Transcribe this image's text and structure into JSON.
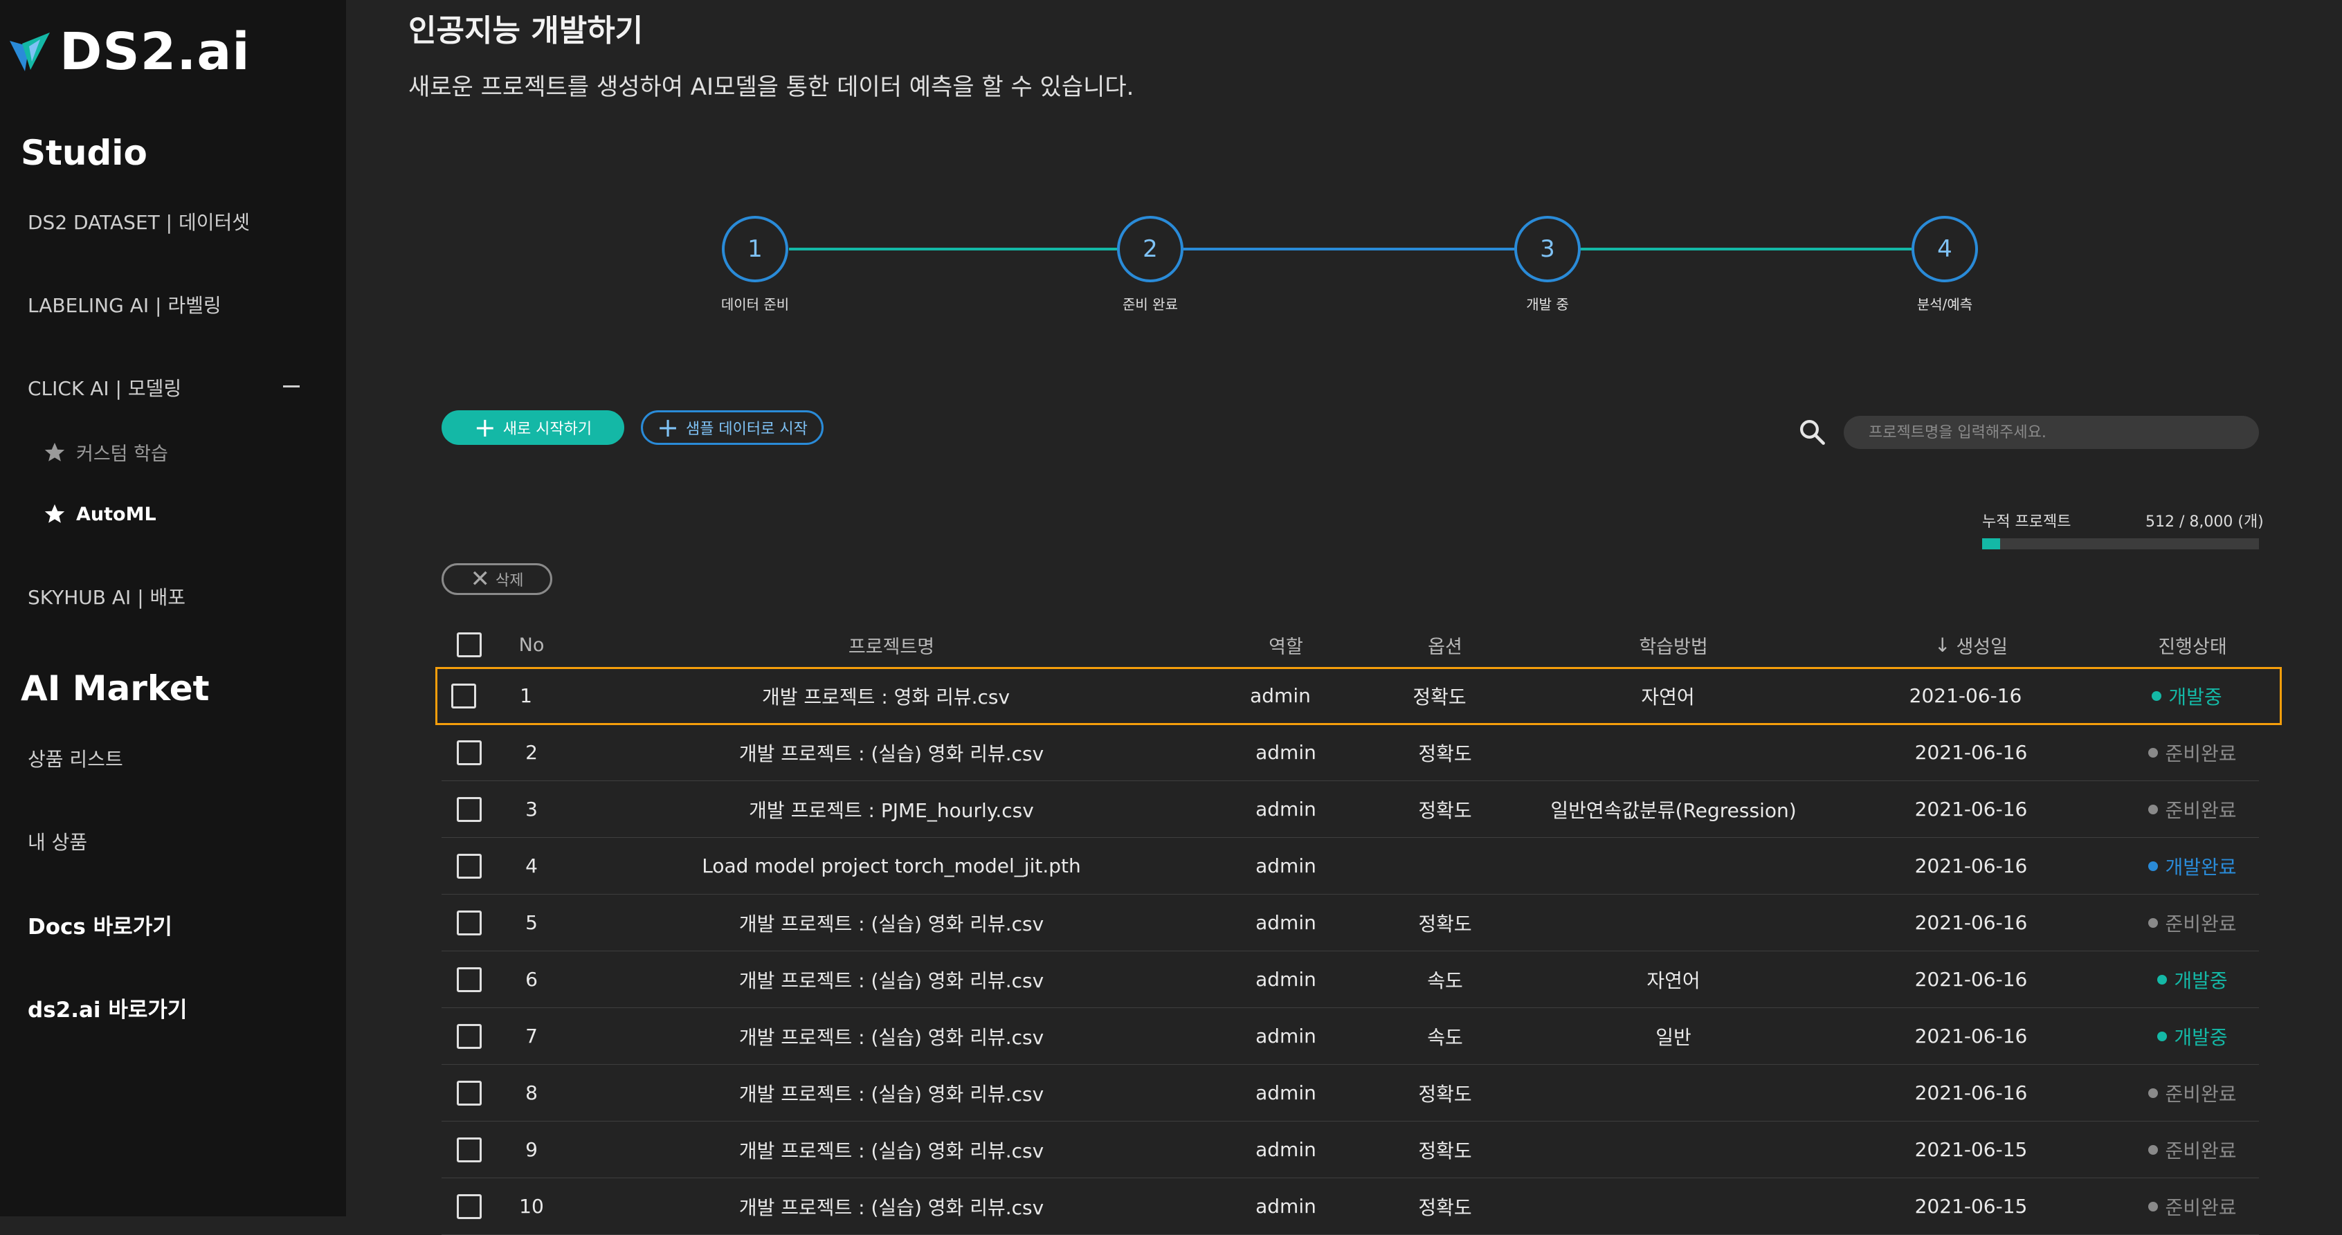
{
  "brand": {
    "logo_text": "DS2.ai"
  },
  "sidebar": {
    "studio_title": "Studio",
    "items": {
      "dataset": "DS2 DATASET | 데이터셋",
      "labeling": "LABELING AI | 라벨링",
      "clickai": "CLICK AI | 모델링",
      "custom": "커스텀 학습",
      "automl": "AutoML",
      "skyhub": "SKYHUB AI | 배포"
    },
    "market_title": "AI Market",
    "market_items": {
      "product_list": "상품 리스트",
      "my_products": "내 상품"
    },
    "docs_link": "Docs 바로가기",
    "ds2_link": "ds2.ai 바로가기"
  },
  "header": {
    "title": "인공지능 개발하기",
    "description": "새로운 프로젝트를 생성하여 AI모델을 통한 데이터 예측을 할 수 있습니다."
  },
  "steps": [
    {
      "number": "1",
      "label": "데이터 준비"
    },
    {
      "number": "2",
      "label": "준비 완료"
    },
    {
      "number": "3",
      "label": "개발 중"
    },
    {
      "number": "4",
      "label": "분석/예측"
    }
  ],
  "toolbar": {
    "new_start": "새로 시작하기",
    "sample_start": "샘플 데이터로 시작",
    "search_placeholder": "프로젝트명을 입력해주세요.",
    "delete": "삭제"
  },
  "cumulative": {
    "label": "누적 프로젝트",
    "value_text": "512 / 8,000 (개)",
    "used": 512,
    "total": 8000
  },
  "table": {
    "headers": {
      "no": "No",
      "name": "프로젝트명",
      "role": "역할",
      "option": "옵션",
      "method": "학습방법",
      "date": "생성일",
      "status": "진행상태"
    },
    "rows": [
      {
        "no": "1",
        "name": "개발 프로젝트 : 영화 리뷰.csv",
        "role": "admin",
        "option": "정확도",
        "method": "자연어",
        "date": "2021-06-16",
        "status": "개발중"
      },
      {
        "no": "2",
        "name": "개발 프로젝트 : (실습) 영화 리뷰.csv",
        "role": "admin",
        "option": "정확도",
        "method": "",
        "date": "2021-06-16",
        "status": "준비완료"
      },
      {
        "no": "3",
        "name": "개발 프로젝트 : PJME_hourly.csv",
        "role": "admin",
        "option": "정확도",
        "method": "일반연속값분류(Regression)",
        "date": "2021-06-16",
        "status": "준비완료"
      },
      {
        "no": "4",
        "name": "Load model project torch_model_jit.pth",
        "role": "admin",
        "option": "",
        "method": "",
        "date": "2021-06-16",
        "status": "개발완료"
      },
      {
        "no": "5",
        "name": "개발 프로젝트 : (실습) 영화 리뷰.csv",
        "role": "admin",
        "option": "정확도",
        "method": "",
        "date": "2021-06-16",
        "status": "준비완료"
      },
      {
        "no": "6",
        "name": "개발 프로젝트 : (실습) 영화 리뷰.csv",
        "role": "admin",
        "option": "속도",
        "method": "자연어",
        "date": "2021-06-16",
        "status": "개발중"
      },
      {
        "no": "7",
        "name": "개발 프로젝트 : (실습) 영화 리뷰.csv",
        "role": "admin",
        "option": "속도",
        "method": "일반",
        "date": "2021-06-16",
        "status": "개발중"
      },
      {
        "no": "8",
        "name": "개발 프로젝트 : (실습) 영화 리뷰.csv",
        "role": "admin",
        "option": "정확도",
        "method": "",
        "date": "2021-06-16",
        "status": "준비완료"
      },
      {
        "no": "9",
        "name": "개발 프로젝트 : (실습) 영화 리뷰.csv",
        "role": "admin",
        "option": "정확도",
        "method": "",
        "date": "2021-06-15",
        "status": "준비완료"
      },
      {
        "no": "10",
        "name": "개발 프로젝트 : (실습) 영화 리뷰.csv",
        "role": "admin",
        "option": "정확도",
        "method": "",
        "date": "2021-06-15",
        "status": "준비완료"
      }
    ]
  },
  "colors": {
    "accent_teal": "#14b8a6",
    "accent_blue": "#2a8bd8",
    "selected_outline": "#f59e0b",
    "status_developing": "#14b8a6",
    "status_ready": "#8a8a8a",
    "status_done": "#2a8bd8"
  },
  "icons": {
    "logo": "ds2-logo-icon",
    "star": "star-icon",
    "search": "search-icon",
    "plus": "plus-icon",
    "close": "close-icon",
    "sort": "arrow-down-icon",
    "collapse": "minus-icon"
  }
}
